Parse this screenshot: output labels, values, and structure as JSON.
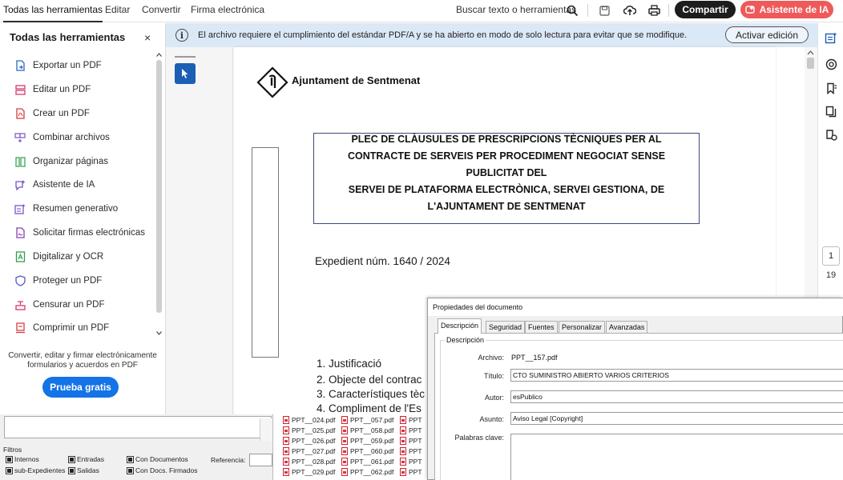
{
  "topbar": {
    "menu": [
      "Todas las herramientas",
      "Editar",
      "Convertir",
      "Firma electrónica"
    ],
    "search_label": "Buscar texto o herramientas",
    "share_label": "Compartir",
    "ai_label": "Asistente de IA",
    "icons": [
      "search-icon",
      "save-icon",
      "upload-icon",
      "print-icon",
      "ai-assistant-icon"
    ]
  },
  "tools_panel": {
    "title": "Todas las herramientas",
    "close": "×",
    "items": [
      {
        "label": "Exportar un PDF",
        "icon": "export-pdf-icon",
        "color": "#2a68c4"
      },
      {
        "label": "Editar un PDF",
        "icon": "edit-pdf-icon",
        "color": "#d63a6a"
      },
      {
        "label": "Crear un PDF",
        "icon": "create-pdf-icon",
        "color": "#d63b3b"
      },
      {
        "label": "Combinar archivos",
        "icon": "combine-files-icon",
        "color": "#7b55c9"
      },
      {
        "label": "Organizar páginas",
        "icon": "organize-pages-icon",
        "color": "#2e9e4a"
      },
      {
        "label": "Asistente de IA",
        "icon": "ai-assistant-icon",
        "color": "#7b55c9"
      },
      {
        "label": "Resumen generativo",
        "icon": "generative-summary-icon",
        "color": "#7b55c9"
      },
      {
        "label": "Solicitar firmas electrónicas",
        "icon": "request-signatures-icon",
        "color": "#8b3fb8"
      },
      {
        "label": "Digitalizar y OCR",
        "icon": "scan-ocr-icon",
        "color": "#2e9e4a"
      },
      {
        "label": "Proteger un PDF",
        "icon": "protect-pdf-icon",
        "color": "#5a58c8"
      },
      {
        "label": "Censurar un PDF",
        "icon": "redact-pdf-icon",
        "color": "#d63a6a"
      },
      {
        "label": "Comprimir un PDF",
        "icon": "compress-pdf-icon",
        "color": "#d63b3b"
      }
    ],
    "promo": "Convertir, editar y firmar electrónicamente formularios y acuerdos en PDF",
    "trial_label": "Prueba gratis"
  },
  "notice": {
    "text": "El archivo requiere el cumplimiento del estándar PDF/A y se ha abierto en modo de solo lectura para evitar que se modifique.",
    "button": "Activar edición"
  },
  "document": {
    "logo_text": "Ajuntament de Sentmenat",
    "title_lines": [
      "PLEC DE CLÀUSULES DE PRESCRIPCIONS TÈCNIQUES PER AL",
      "CONTRACTE DE SERVEIS PER PROCEDIMENT NEGOCIAT SENSE",
      "PUBLICITAT DEL",
      "SERVEI DE PLATAFORMA ELECTRÒNICA, SERVEI GESTIONA, DE",
      "L'AJUNTAMENT DE SENTMENAT"
    ],
    "expedient": "Expedient núm.   1640 / 2024",
    "toc": [
      "1. Justificació",
      "2. Objecte del contrac",
      "3. Característiques tèc",
      "4. Compliment de l'Es"
    ]
  },
  "pager": {
    "current": "1",
    "total": "19"
  },
  "right_rail_icons": [
    "comment-icon",
    "attach-icon",
    "bookmark-icon",
    "copy-pages-icon",
    "accessibility-icon"
  ],
  "bg_window": {
    "filters_label": "Filtros",
    "checkboxes": [
      {
        "label": "Internos"
      },
      {
        "label": "Entradas"
      },
      {
        "label": "Con Documentos"
      },
      {
        "label": "sub-Expedientes"
      },
      {
        "label": "Salidas"
      },
      {
        "label": "Con Docs. Firmados"
      }
    ],
    "reference_label": "Referencia:"
  },
  "file_list": {
    "col1": [
      "PPT__024.pdf",
      "PPT__025.pdf",
      "PPT__026.pdf",
      "PPT__027.pdf",
      "PPT__028.pdf",
      "PPT__029.pdf"
    ],
    "col2": [
      "PPT__057.pdf",
      "PPT__058.pdf",
      "PPT__059.pdf",
      "PPT__060.pdf",
      "PPT__061.pdf",
      "PPT__062.pdf"
    ],
    "col3": [
      "PPT",
      "PPT",
      "PPT",
      "PPT",
      "PPT",
      "PPT"
    ]
  },
  "properties": {
    "title": "Propiedades del documento",
    "tabs": [
      "Descripción",
      "Seguridad",
      "Fuentes",
      "Personalizar",
      "Avanzadas"
    ],
    "group_label": "Descripción",
    "fields": {
      "archivo_label": "Archivo:",
      "archivo": "PPT__157.pdf",
      "titulo_label": "Título:",
      "titulo": "CTO SUMINISTRO ABIERTO VARIOS CRITERIOS",
      "autor_label": "Autor:",
      "autor": "esPublico",
      "asunto_label": "Asunto:",
      "asunto": "Aviso Legal [Copyright]",
      "keywords_label": "Palabras clave:"
    }
  }
}
